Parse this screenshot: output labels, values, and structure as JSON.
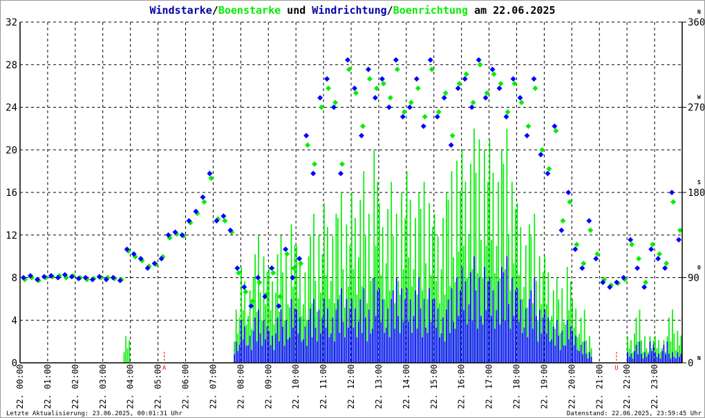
{
  "chart_data": {
    "type": "bar+scatter",
    "title_parts": [
      {
        "text": "Windstarke",
        "color": "#0000aa"
      },
      {
        "text": "/",
        "color": "#000000"
      },
      {
        "text": "Boenstarke",
        "color": "#00ee00"
      },
      {
        "text": " und ",
        "color": "#000000"
      },
      {
        "text": "Windrichtung",
        "color": "#0000aa"
      },
      {
        "text": "/",
        "color": "#000000"
      },
      {
        "text": "Boenrichtung",
        "color": "#00ee00"
      },
      {
        "text": " am 22.06.2025",
        "color": "#000000"
      }
    ],
    "colors": {
      "wind": "#0000ff",
      "gust": "#00ee00",
      "grid": "#000000",
      "marker": "#ff0000"
    },
    "interval_minutes": 15,
    "xlim_hours": [
      0,
      24
    ],
    "y_left": {
      "range": [
        0,
        32
      ],
      "ticks": [
        "0",
        "4",
        "8",
        "12",
        "16",
        "20",
        "24",
        "28",
        "32"
      ]
    },
    "y_right": {
      "range": [
        0,
        360
      ],
      "ticks": [
        "0",
        "90",
        "180",
        "270",
        "360"
      ],
      "compass": [
        "N",
        "O",
        "S",
        "W",
        "N"
      ]
    },
    "x_ticks": [
      "22. 00:00",
      "22. 01:00",
      "22. 02:00",
      "22. 03:00",
      "22. 04:00",
      "22. 05:00",
      "22. 06:00",
      "22. 07:00",
      "22. 08:00",
      "22. 09:00",
      "22. 10:00",
      "22. 11:00",
      "22. 12:00",
      "22. 13:00",
      "22. 14:00",
      "22. 15:00",
      "22. 16:00",
      "22. 17:00",
      "22. 18:00",
      "22. 19:00",
      "22. 20:00",
      "22. 21:00",
      "22. 22:00",
      "22. 23:00"
    ],
    "sun_markers": [
      {
        "label": "A",
        "hour": 5.23
      },
      {
        "label": "U",
        "hour": 21.62
      }
    ],
    "wind_speed": [
      0,
      0,
      0,
      0,
      0,
      0,
      0,
      0,
      0,
      0,
      0,
      0,
      0,
      0,
      0,
      0,
      0,
      0,
      0,
      0,
      0,
      0,
      0,
      0,
      0,
      0,
      0,
      0,
      0,
      0,
      0,
      2,
      4,
      3,
      5,
      4,
      3,
      5,
      4,
      6,
      5,
      4,
      6,
      5,
      6,
      5,
      7,
      6,
      6,
      7,
      5,
      8,
      7,
      6,
      8,
      7,
      7,
      8,
      6,
      7,
      6,
      5,
      7,
      8,
      9,
      10,
      8,
      9,
      8,
      9,
      10,
      8,
      7,
      6,
      8,
      5,
      5,
      4,
      3,
      4,
      3,
      2,
      1,
      0,
      0,
      0,
      0,
      0,
      1,
      2,
      1,
      2,
      1,
      2,
      1,
      1
    ],
    "gust_speed": [
      0,
      0,
      0,
      0,
      0,
      0,
      0,
      0,
      0,
      0,
      0,
      0,
      0,
      0,
      0,
      2.5,
      0,
      0,
      0,
      0,
      0,
      0,
      0,
      0,
      0,
      0,
      0,
      0,
      0,
      0,
      0,
      5,
      9,
      8,
      12,
      10,
      9,
      12,
      10,
      13,
      11,
      10,
      14,
      12,
      15,
      14,
      16,
      13,
      16,
      18,
      14,
      20,
      15,
      17,
      14,
      16,
      18,
      16,
      17,
      15,
      14,
      16,
      18,
      19,
      20,
      22,
      21,
      20,
      21,
      20,
      22,
      17,
      15,
      13,
      14,
      10,
      10,
      8,
      7,
      9,
      6,
      5,
      2.5,
      0,
      0,
      0,
      0,
      0,
      2.5,
      5,
      2.5,
      2.5,
      2.5,
      2.5,
      5,
      3
    ],
    "wind_direction": [
      90,
      92,
      88,
      91,
      92,
      90,
      93,
      91,
      89,
      90,
      88,
      91,
      88,
      90,
      87,
      120,
      115,
      110,
      100,
      105,
      110,
      135,
      138,
      135,
      150,
      160,
      175,
      200,
      150,
      155,
      140,
      100,
      80,
      60,
      90,
      70,
      100,
      60,
      120,
      90,
      110,
      240,
      200,
      280,
      300,
      270,
      200,
      320,
      290,
      240,
      310,
      280,
      300,
      270,
      320,
      260,
      270,
      300,
      250,
      320,
      260,
      280,
      230,
      290,
      300,
      270,
      320,
      280,
      310,
      290,
      260,
      300,
      280,
      240,
      300,
      220,
      200,
      250,
      140,
      180,
      120,
      100,
      150,
      110,
      85,
      80,
      85,
      90,
      130,
      100,
      80,
      120,
      110,
      100,
      180,
      130
    ],
    "gust_direction": [
      88,
      90,
      87,
      90,
      91,
      92,
      90,
      92,
      90,
      88,
      89,
      90,
      90,
      89,
      88,
      118,
      112,
      108,
      102,
      104,
      112,
      132,
      136,
      134,
      148,
      158,
      170,
      195,
      152,
      150,
      138,
      95,
      75,
      65,
      85,
      72,
      95,
      70,
      115,
      100,
      105,
      230,
      210,
      270,
      290,
      275,
      210,
      310,
      285,
      250,
      300,
      290,
      295,
      280,
      310,
      265,
      275,
      290,
      260,
      310,
      265,
      285,
      240,
      295,
      305,
      275,
      315,
      285,
      305,
      295,
      265,
      295,
      275,
      250,
      290,
      225,
      205,
      245,
      150,
      170,
      125,
      105,
      140,
      115,
      88,
      82,
      84,
      88,
      125,
      110,
      85,
      125,
      115,
      105,
      170,
      140
    ]
  },
  "footer": {
    "left": "Letzte Aktualisierung: 23.06.2025, 00:01:31 Uhr",
    "right": "Datenstand: 22.06.2025, 23:59:45 Uhr"
  }
}
